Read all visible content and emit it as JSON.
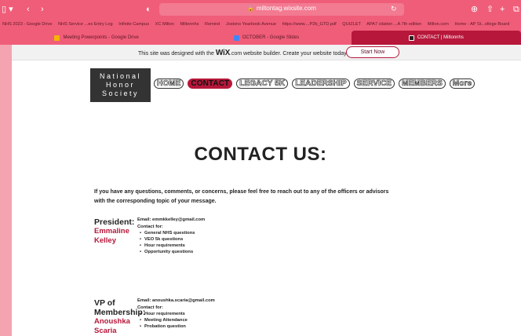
{
  "browser": {
    "url": "miltontag.wixsite.com",
    "bookmarks": [
      "NHS 2023 - Google Drive",
      "NHS Service ...es Entry Log",
      "Infinite Campus",
      "XC Milton",
      "Miltonnhs",
      "Remind",
      "Jostens Yearbook Avenue",
      "https://www....P2b_GTD.pdf",
      "QUIZLET",
      "APA7 citation ...A 7th edition",
      "Milton.com",
      "Home - AP St...ollege Board"
    ],
    "tabs": [
      {
        "label": "Meeting Powerpoints - Google Drive",
        "icon": "google-drive-icon",
        "color": "#f4b400"
      },
      {
        "label": "OCTOBER - Google Slides",
        "icon": "google-slides-icon",
        "color": "#4285f4"
      },
      {
        "label": "CONTACT | Miltonnhs",
        "icon": "wix-icon",
        "color": "#222222"
      }
    ]
  },
  "wix_banner": {
    "text_before": "This site was designed with the",
    "brand": "WiX",
    "text_after": ".com website builder. Create your website today.",
    "button": "Start Now"
  },
  "site": {
    "logo_lines": [
      "National",
      "Honor",
      "Society"
    ],
    "nav": [
      "HOME",
      "CONTACT",
      "LEGACY 5K",
      "LEADERSHIP",
      "SERVICE",
      "MEMBERS",
      "More"
    ],
    "active_nav": "CONTACT"
  },
  "page": {
    "title": "CONTACT US:",
    "intro": "If you have any questions, comments, or concerns, please feel free to reach out to any of the officers or advisors with the corresponding topic of your message."
  },
  "officers": [
    {
      "role": "President:",
      "name_lines": [
        "Emmaline",
        "Kelley"
      ],
      "email": "Email: emmkkelley@gmail.com",
      "contact_for": "Contact for:",
      "topics": [
        "General NHS questions",
        "VEO 5k questions",
        "Hour requirements",
        "Opportunity questions"
      ]
    },
    {
      "role_lines": [
        "VP of",
        "Membership:"
      ],
      "name_lines": [
        "Anoushka",
        "Scaria"
      ],
      "email": "Email: anoushka.scaria@gmail.com",
      "contact_for": "Contact for:",
      "topics": [
        "Hour requirements",
        "Meeting Attendance",
        "Probation question"
      ]
    }
  ],
  "colors": {
    "accent": "#b6173a",
    "chrome": "#f05d79",
    "side": "#f4a3b1"
  }
}
